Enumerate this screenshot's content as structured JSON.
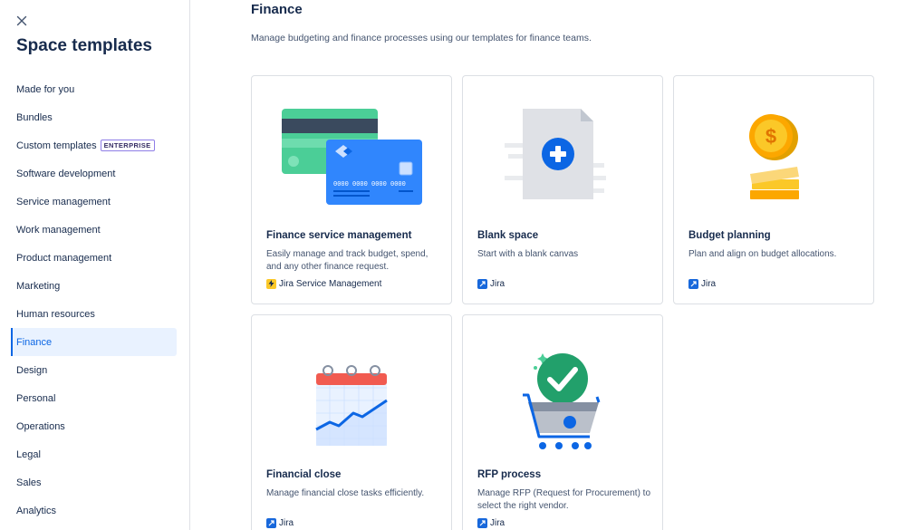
{
  "sidebar": {
    "title": "Space templates",
    "items": [
      {
        "label": "Made for you"
      },
      {
        "label": "Bundles"
      },
      {
        "label": "Custom templates",
        "badge": "ENTERPRISE"
      },
      {
        "label": "Software development"
      },
      {
        "label": "Service management"
      },
      {
        "label": "Work management"
      },
      {
        "label": "Product management"
      },
      {
        "label": "Marketing"
      },
      {
        "label": "Human resources"
      },
      {
        "label": "Finance",
        "active": true
      },
      {
        "label": "Design"
      },
      {
        "label": "Personal"
      },
      {
        "label": "Operations"
      },
      {
        "label": "Legal"
      },
      {
        "label": "Sales"
      },
      {
        "label": "Analytics"
      }
    ]
  },
  "main": {
    "title": "Finance",
    "description": "Manage budgeting and finance processes using our templates for finance teams.",
    "cards": [
      {
        "title": "Finance service management",
        "description": "Easily manage and track budget, spend, and any other finance request.",
        "product": "Jira Service Management",
        "card_number_text": "0000 0000 0000 0000"
      },
      {
        "title": "Blank space",
        "description": "Start with a blank canvas",
        "product": "Jira"
      },
      {
        "title": "Budget planning",
        "description": "Plan and align on budget allocations.",
        "product": "Jira"
      },
      {
        "title": "Financial close",
        "description": "Manage financial close tasks efficiently.",
        "product": "Jira"
      },
      {
        "title": "RFP process",
        "description": "Manage RFP (Request for Procurement) to select the right vendor.",
        "product": "Jira"
      }
    ]
  },
  "colors": {
    "accent": "#0c66e4",
    "active_bg": "#e9f2ff",
    "jira_blue": "#1868db",
    "jsm_yellow": "#fbc828"
  }
}
